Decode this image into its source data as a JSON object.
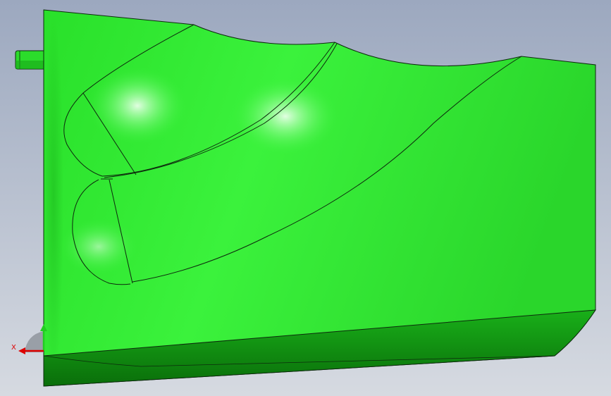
{
  "viewport": {
    "background_top": "#9ca8bf",
    "background_bottom": "#d6dae1"
  },
  "model": {
    "color": "#33ee33",
    "color_dark": "#0b8a0b",
    "edge_color": "#0d2a0d"
  },
  "triad": {
    "x_label": "X",
    "x_color": "#dd0000",
    "y_color": "#22cc22"
  }
}
